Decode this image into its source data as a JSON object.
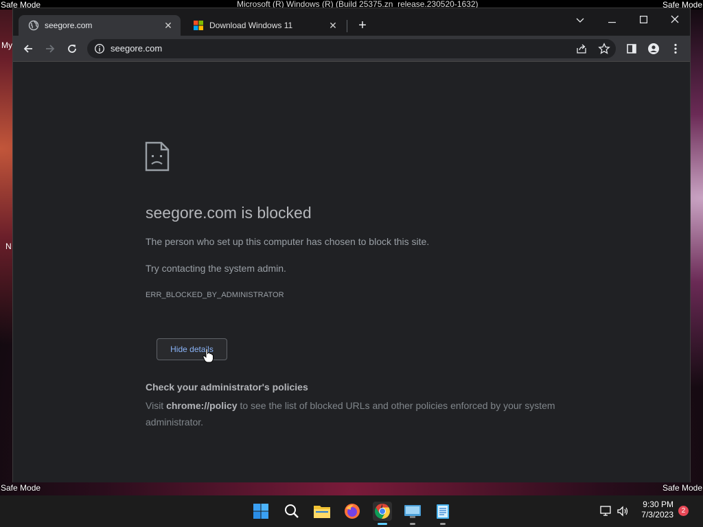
{
  "system": {
    "safe_mode_label": "Safe Mode",
    "build_string": "Microsoft (R) Windows (R) (Build 25375.zn_release.230520-1632)"
  },
  "desktop": {
    "icon_labels": [
      "My",
      "N"
    ]
  },
  "browser": {
    "tabs": [
      {
        "title": "seegore.com",
        "favicon": "globe-icon",
        "active": true
      },
      {
        "title": "Download Windows 11",
        "favicon": "microsoft-logo-icon",
        "active": false
      }
    ],
    "new_tab_label": "+",
    "tab_close_glyph": "✕",
    "address_bar": {
      "url": "seegore.com"
    }
  },
  "error_page": {
    "title": "seegore.com is blocked",
    "description": "The person who set up this computer has chosen to block this site.",
    "contact": "Try contacting the system admin.",
    "error_code": "ERR_BLOCKED_BY_ADMINISTRATOR",
    "details_button": "Hide details",
    "policy_heading": "Check your administrator's policies",
    "policy_prefix": "Visit ",
    "policy_link": "chrome://policy",
    "policy_suffix": " to see the list of blocked URLs and other policies enforced by your system administrator."
  },
  "taskbar": {
    "time": "9:30 PM",
    "date": "7/3/2023",
    "notification_count": "2",
    "apps": [
      "start-icon",
      "search-icon",
      "file-explorer-icon",
      "firefox-icon",
      "chrome-icon",
      "remote-desktop-icon",
      "notepad-icon"
    ]
  },
  "colors": {
    "accent_link": "#8ab4f8",
    "page_bg": "#202124",
    "toolbar_bg": "#35363a"
  }
}
